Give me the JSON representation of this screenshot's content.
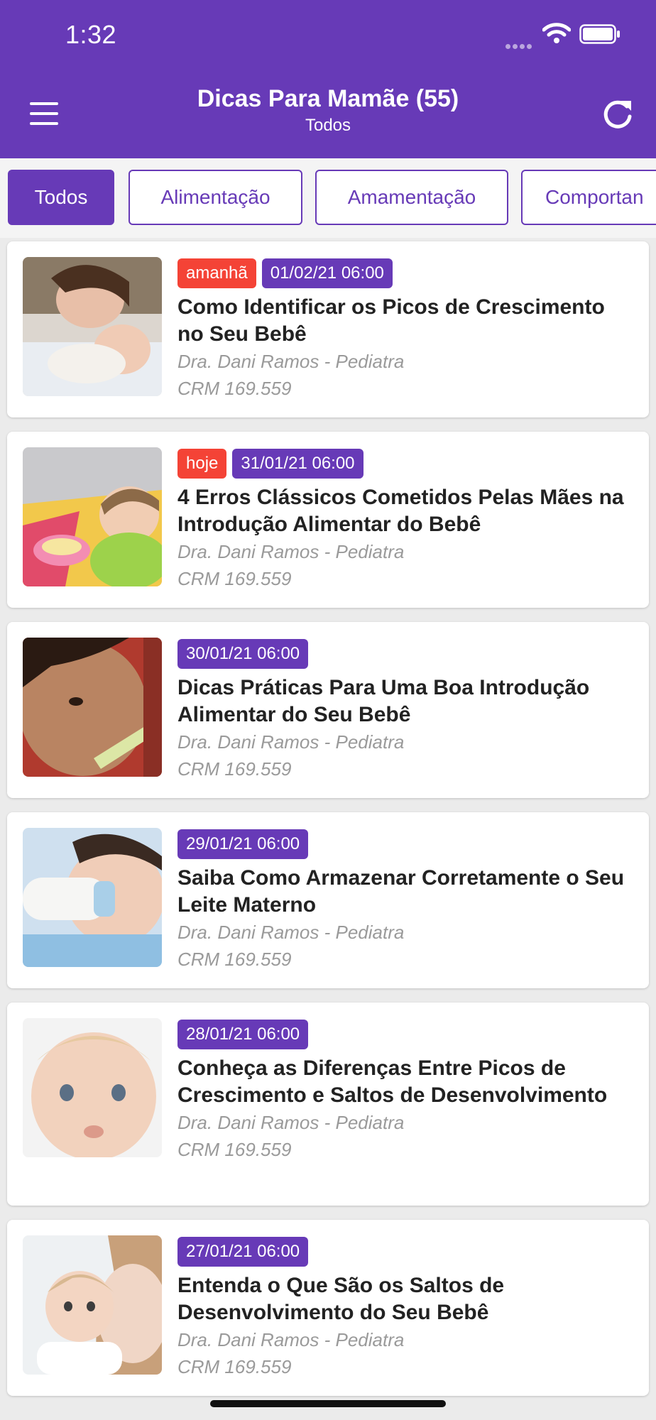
{
  "status_bar": {
    "time": "1:32"
  },
  "header": {
    "title": "Dicas Para Mamãe (55)",
    "subtitle": "Todos"
  },
  "filters": [
    {
      "label": "Todos",
      "active": true
    },
    {
      "label": "Alimentação",
      "active": false
    },
    {
      "label": "Amamentação",
      "active": false
    },
    {
      "label": "Comportan",
      "active": false
    }
  ],
  "articles": [
    {
      "relative": "amanhã",
      "date": "01/02/21 06:00",
      "title": "Como Identificar os Picos de Crescimento no Seu Bebê",
      "author": "Dra. Dani Ramos - Pediatra",
      "crm": "CRM 169.559"
    },
    {
      "relative": "hoje",
      "date": "31/01/21 06:00",
      "title": "4 Erros Clássicos Cometidos Pelas Mães na Introdução Alimentar do Bebê",
      "author": "Dra. Dani Ramos - Pediatra",
      "crm": "CRM 169.559"
    },
    {
      "date": "30/01/21 06:00",
      "title": "Dicas Práticas Para Uma Boa Introdução Alimentar do Seu Bebê",
      "author": "Dra. Dani Ramos - Pediatra",
      "crm": "CRM 169.559"
    },
    {
      "date": "29/01/21 06:00",
      "title": "Saiba Como Armazenar Corretamente o Seu Leite Materno",
      "author": "Dra. Dani Ramos - Pediatra",
      "crm": "CRM 169.559"
    },
    {
      "date": "28/01/21 06:00",
      "title": "Conheça as Diferenças Entre Picos de Crescimento e Saltos de Desenvolvimento",
      "author": "Dra. Dani Ramos - Pediatra",
      "crm": "CRM 169.559"
    },
    {
      "date": "27/01/21 06:00",
      "title": "Entenda o Que São os Saltos de Desenvolvimento do Seu Bebê",
      "author": "Dra. Dani Ramos - Pediatra",
      "crm": "CRM 169.559"
    }
  ],
  "colors": {
    "primary": "#673ab7",
    "badge_red": "#f44336",
    "muted_text": "#9a9a9a"
  },
  "icons": {
    "menu": "hamburger-icon",
    "refresh": "refresh-icon",
    "wifi": "wifi-icon",
    "battery": "battery-icon"
  }
}
